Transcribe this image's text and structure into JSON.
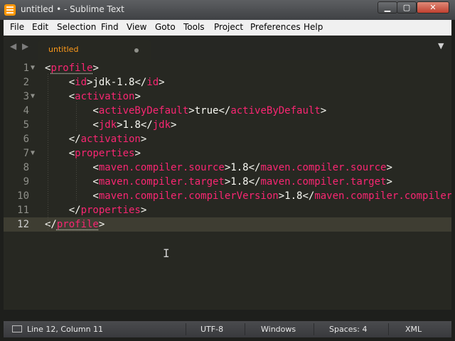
{
  "window": {
    "title": "untitled • - Sublime Text",
    "minimize_glyph": "▁",
    "maximize_glyph": "▢",
    "close_glyph": "✕"
  },
  "menu": [
    "File",
    "Edit",
    "Selection",
    "Find",
    "View",
    "Goto",
    "Tools",
    "Project",
    "Preferences",
    "Help"
  ],
  "tabs": {
    "back_glyph": "◀",
    "forward_glyph": "▶",
    "active_label": "untitled",
    "dropdown_glyph": "▼"
  },
  "editor": {
    "fold_glyph": "▼",
    "lines": [
      {
        "num": "1",
        "segments": [
          [
            "<",
            ""
          ],
          [
            "profile",
            "tag ul"
          ],
          [
            ">",
            ""
          ]
        ]
      },
      {
        "num": "2",
        "segments": [
          [
            "    <",
            ""
          ],
          [
            "id",
            "tag"
          ],
          [
            ">jdk-1.8</",
            ""
          ],
          [
            "id",
            "tag"
          ],
          [
            ">",
            ""
          ]
        ]
      },
      {
        "num": "3",
        "segments": [
          [
            "    <",
            ""
          ],
          [
            "activation",
            "tag"
          ],
          [
            ">",
            ""
          ]
        ]
      },
      {
        "num": "4",
        "segments": [
          [
            "        <",
            ""
          ],
          [
            "activeByDefault",
            "tag"
          ],
          [
            ">true</",
            ""
          ],
          [
            "activeByDefault",
            "tag"
          ],
          [
            ">",
            ""
          ]
        ]
      },
      {
        "num": "5",
        "segments": [
          [
            "        <",
            ""
          ],
          [
            "jdk",
            "tag"
          ],
          [
            ">1.8</",
            ""
          ],
          [
            "jdk",
            "tag"
          ],
          [
            ">",
            ""
          ]
        ]
      },
      {
        "num": "6",
        "segments": [
          [
            "    </",
            ""
          ],
          [
            "activation",
            "tag"
          ],
          [
            ">",
            ""
          ]
        ]
      },
      {
        "num": "7",
        "segments": [
          [
            "    <",
            ""
          ],
          [
            "properties",
            "tag"
          ],
          [
            ">",
            ""
          ]
        ]
      },
      {
        "num": "8",
        "segments": [
          [
            "        <",
            ""
          ],
          [
            "maven.compiler.source",
            "tag"
          ],
          [
            ">1.8</",
            ""
          ],
          [
            "maven.compiler.source",
            "tag"
          ],
          [
            ">",
            ""
          ]
        ]
      },
      {
        "num": "9",
        "segments": [
          [
            "        <",
            ""
          ],
          [
            "maven.compiler.target",
            "tag"
          ],
          [
            ">1.8</",
            ""
          ],
          [
            "maven.compiler.target",
            "tag"
          ],
          [
            ">",
            ""
          ]
        ]
      },
      {
        "num": "10",
        "segments": [
          [
            "        <",
            ""
          ],
          [
            "maven.compiler.compilerVersion",
            "tag"
          ],
          [
            ">1.8</",
            ""
          ],
          [
            "maven.compiler.compilerVersion",
            "tag"
          ],
          [
            ">",
            ""
          ]
        ]
      },
      {
        "num": "11",
        "segments": [
          [
            "    </",
            ""
          ],
          [
            "properties",
            "tag"
          ],
          [
            ">",
            ""
          ]
        ]
      },
      {
        "num": "12",
        "segments": [
          [
            "</",
            ""
          ],
          [
            "profile",
            "tag ul"
          ],
          [
            ">",
            ""
          ]
        ]
      }
    ],
    "foldable_lines": [
      1,
      3,
      7
    ],
    "current_line": 12,
    "cursor_glyph": "I"
  },
  "status": {
    "position": "Line 12, Column 11",
    "encoding": "UTF-8",
    "line_endings": "Windows",
    "indentation": "Spaces: 4",
    "syntax": "XML"
  },
  "colors": {
    "background": "#272822",
    "tag": "#f92672",
    "text": "#f8f8f2",
    "tab_label": "#ff9a1a"
  }
}
